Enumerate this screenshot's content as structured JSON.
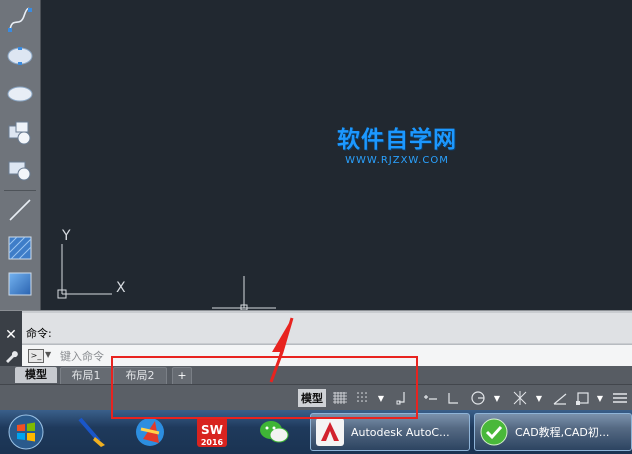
{
  "watermark": {
    "title": "软件自学网",
    "subtitle": "WWW.RJZXW.COM"
  },
  "ucs": {
    "y_label": "Y",
    "x_label": "X"
  },
  "toolbar": {
    "tools": [
      "spline-icon",
      "ellipse-icon",
      "ellipse-arc-icon",
      "insert-block-icon",
      "create-block-icon",
      "point-icon",
      "hatch-icon",
      "gradient-icon"
    ]
  },
  "command": {
    "history_label": "命令:",
    "input_placeholder": "键入命令",
    "close_glyph": "✕"
  },
  "tabs": {
    "model": "模型",
    "layout1": "布局1",
    "layout2": "布局2",
    "add": "+"
  },
  "statusbar": {
    "model_label": "模型"
  },
  "taskbar": {
    "apps": [
      "windows-start-icon",
      "toolbox-icon",
      "autodesk-app-icon",
      "solidworks-icon",
      "wechat-icon"
    ],
    "solidworks_label_top": "SW",
    "solidworks_label_year": "2016",
    "window1": "Autodesk AutoC...",
    "window2": "CAD教程,CAD初..."
  },
  "colors": {
    "annotation_red": "#e8231f",
    "watermark_blue": "#1c98ff"
  }
}
